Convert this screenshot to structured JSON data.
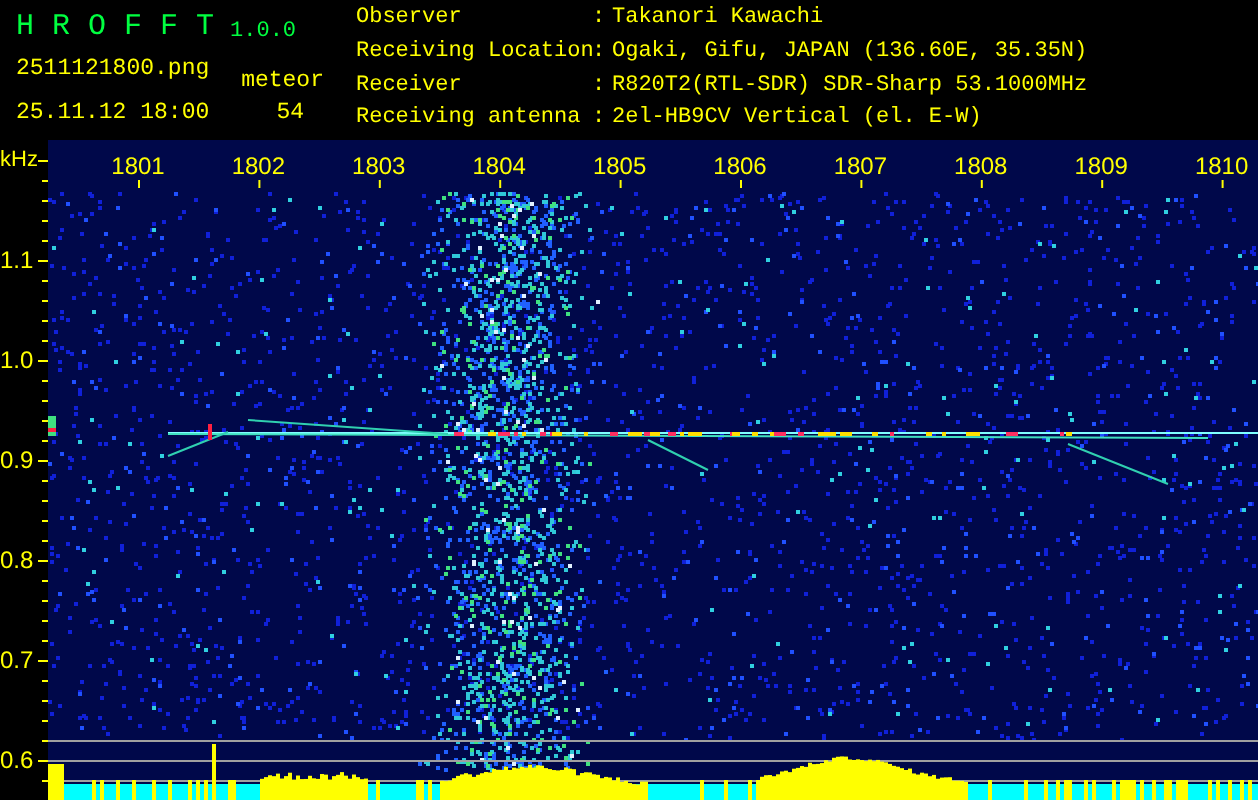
{
  "app": {
    "title": "H R O F F T",
    "version": "1.0.0",
    "filename": "2511121800.png",
    "timestamp": "25.11.12 18:00",
    "counter_label": "meteor",
    "counter_value": "54"
  },
  "station_info": [
    {
      "label": "Observer",
      "separator": ":",
      "value": "Takanori Kawachi"
    },
    {
      "label": "Receiving Location",
      "separator": ":",
      "value": "Ogaki, Gifu, JAPAN (136.60E, 35.35N)"
    },
    {
      "label": "Receiver",
      "separator": ":",
      "value": "R820T2(RTL-SDR) SDR-Sharp 53.1000MHz"
    },
    {
      "label": "Receiving antenna",
      "separator": ":",
      "value": "2el-HB9CV Vertical (el. E-W)"
    }
  ],
  "spectrogram": {
    "y_unit": "kHz",
    "y_labels": [
      "1.1",
      "1.0",
      "0.9",
      "0.8",
      "0.7",
      "0.6"
    ],
    "x_labels": [
      "1801",
      "1802",
      "1803",
      "1804",
      "1805",
      "1806",
      "1807",
      "1808",
      "1809",
      "1810"
    ]
  }
}
